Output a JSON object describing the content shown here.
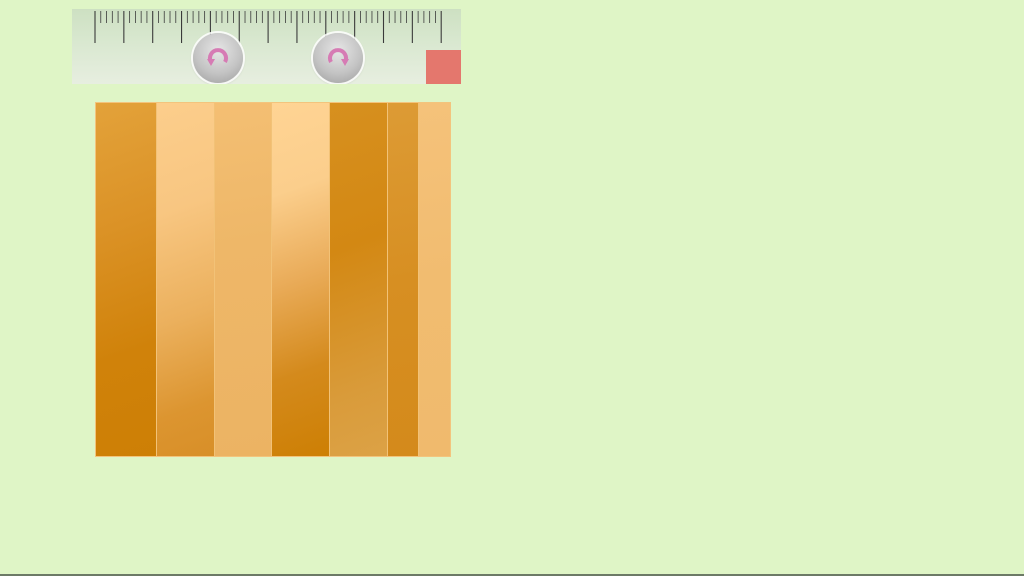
{
  "toolbar": {
    "ruler": {
      "minor_tick_count": 60,
      "major_every": 5
    },
    "buttons": [
      {
        "name": "rotate-left-button",
        "icon": "rotate-counterclockwise-icon"
      },
      {
        "name": "rotate-right-button",
        "icon": "rotate-clockwise-icon"
      }
    ],
    "icon_color": "#d67bb4",
    "corner_button_color": "#e4776d"
  },
  "board": {
    "strip_count": 7,
    "strip_colors": [
      "#d88e1c",
      "#f0bb72",
      "#efb86b",
      "#e7a84f",
      "#d58c1a",
      "#d88f24",
      "#f1bc70"
    ]
  },
  "colors": {
    "background": "#dff5c6",
    "toolbar": "#d9e8d0"
  }
}
